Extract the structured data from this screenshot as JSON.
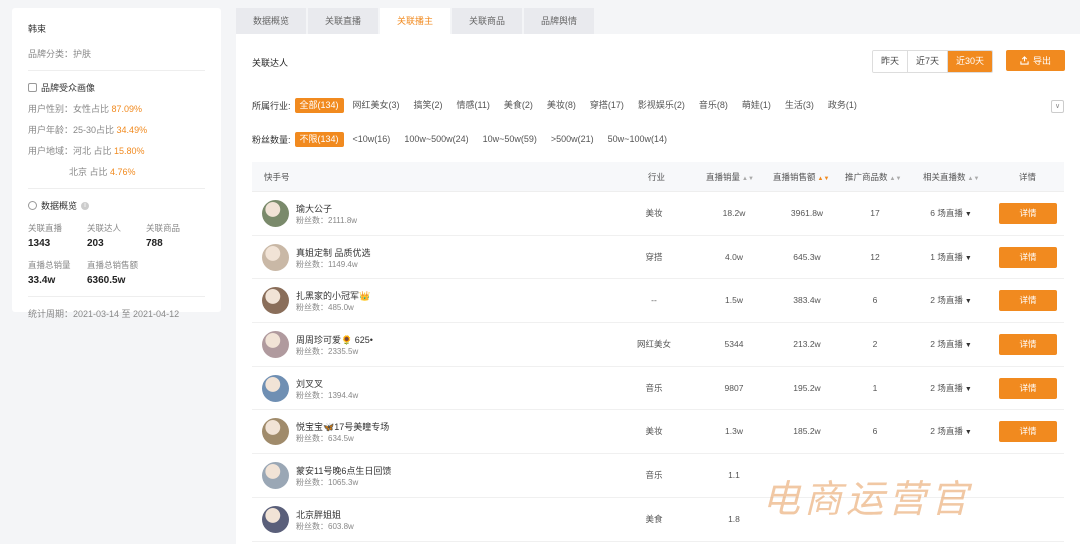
{
  "left": {
    "brand": "韩束",
    "category": "品牌分类：护肤",
    "portrait_title": "品牌受众画像",
    "portrait": [
      {
        "label": "用户性别：女性占比",
        "value": "87.09%"
      },
      {
        "label": "用户年龄：25-30占比",
        "value": "34.49%"
      },
      {
        "label": "用户地域：河北 占比",
        "value": "15.80%"
      },
      {
        "label": "北京 占比",
        "value": "4.76%"
      }
    ],
    "overview_title": "数据概览",
    "stats": [
      {
        "label": "关联直播",
        "value": "1343"
      },
      {
        "label": "关联达人",
        "value": "203"
      },
      {
        "label": "关联商品",
        "value": "788"
      },
      {
        "label": "直播总销量",
        "value": "33.4w"
      },
      {
        "label": "直播总销售额",
        "value": "6360.5w"
      }
    ],
    "period": "统计周期：2021-03-14 至 2021-04-12"
  },
  "tabs": [
    "数据概览",
    "关联直播",
    "关联播主",
    "关联商品",
    "品牌舆情"
  ],
  "main": {
    "title": "关联达人",
    "range": [
      "昨天",
      "近7天",
      "近30天"
    ],
    "export_label": "导出",
    "industry_label": "所属行业:",
    "industry": [
      "全部(134)",
      "网红美女(3)",
      "搞笑(2)",
      "情感(11)",
      "美食(2)",
      "美妆(8)",
      "穿搭(17)",
      "影视娱乐(2)",
      "音乐(8)",
      "萌娃(1)",
      "生活(3)",
      "政务(1)"
    ],
    "fans_label": "粉丝数量:",
    "fans": [
      "不限(134)",
      "<10w(16)",
      "100w~500w(24)",
      "10w~50w(59)",
      ">500w(21)",
      "50w~100w(14)"
    ],
    "columns": [
      "快手号",
      "行业",
      "直播销量",
      "直播销售额",
      "推广商品数",
      "相关直播数",
      "详情"
    ],
    "rows": [
      {
        "name": "瑜大公子",
        "fans": "粉丝数：2111.8w",
        "industry": "美妆",
        "sales": "18.2w",
        "revenue": "3961.8w",
        "goods": "17",
        "lives": "6 场直播",
        "detail": "详情"
      },
      {
        "name": "真姐定制 品质优选",
        "fans": "粉丝数：1149.4w",
        "industry": "穿搭",
        "sales": "4.0w",
        "revenue": "645.3w",
        "goods": "12",
        "lives": "1 场直播",
        "detail": "详情"
      },
      {
        "name": "扎黑家的小冠军👑",
        "fans": "粉丝数：485.0w",
        "industry": "--",
        "sales": "1.5w",
        "revenue": "383.4w",
        "goods": "6",
        "lives": "2 场直播",
        "detail": "详情"
      },
      {
        "name": "周周珍可爱🌻 625•",
        "fans": "粉丝数：2335.5w",
        "industry": "网红美女",
        "sales": "5344",
        "revenue": "213.2w",
        "goods": "2",
        "lives": "2 场直播",
        "detail": "详情"
      },
      {
        "name": "刘叉叉",
        "fans": "粉丝数：1394.4w",
        "industry": "音乐",
        "sales": "9807",
        "revenue": "195.2w",
        "goods": "1",
        "lives": "2 场直播",
        "detail": "详情"
      },
      {
        "name": "悦宝宝🦋17号美瞳专场",
        "fans": "粉丝数：634.5w",
        "industry": "美妆",
        "sales": "1.3w",
        "revenue": "185.2w",
        "goods": "6",
        "lives": "2 场直播",
        "detail": "详情"
      },
      {
        "name": "蒙安11号晚6点生日回馈",
        "fans": "粉丝数：1065.3w",
        "industry": "音乐",
        "sales": "1.1",
        "revenue": "",
        "goods": "",
        "lives": "",
        "detail": ""
      },
      {
        "name": "北京胖姐姐",
        "fans": "粉丝数：603.8w",
        "industry": "美食",
        "sales": "1.8",
        "revenue": "",
        "goods": "",
        "lives": "",
        "detail": ""
      }
    ]
  },
  "watermark": "电商运营官",
  "colors": {
    "accent": "#f18a1f"
  }
}
